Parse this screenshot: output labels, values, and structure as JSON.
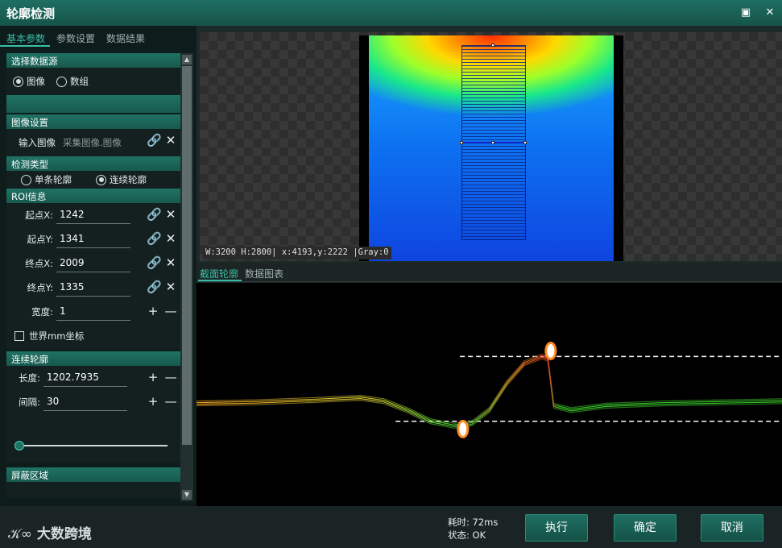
{
  "window": {
    "title": "轮廓检测"
  },
  "left_tabs": [
    "基本参数",
    "参数设置",
    "数据结果"
  ],
  "datasource": {
    "header": "选择数据源",
    "options": [
      {
        "label": "图像",
        "selected": true
      },
      {
        "label": "数组",
        "selected": false
      }
    ]
  },
  "image_settings": {
    "header": "图像设置",
    "label": "输入图像",
    "value": "采集图像.图像"
  },
  "detect_type": {
    "header": "检测类型",
    "options": [
      {
        "label": "单条轮廓",
        "selected": false
      },
      {
        "label": "连续轮廓",
        "selected": true
      }
    ]
  },
  "roi": {
    "header": "ROI信息",
    "fields": [
      {
        "label": "起点X:",
        "value": "1242"
      },
      {
        "label": "起点Y:",
        "value": "1341"
      },
      {
        "label": "终点X:",
        "value": "2009"
      },
      {
        "label": "终点Y:",
        "value": "1335"
      }
    ],
    "width_label": "宽度:",
    "width_value": "1",
    "world_checkbox": "世界mm坐标"
  },
  "continuous": {
    "header": "连续轮廓",
    "length_label": "长度:",
    "length_value": "1202.7935",
    "interval_label": "间隔:",
    "interval_value": "30"
  },
  "mask": {
    "header": "屏蔽区域"
  },
  "viewer": {
    "status": "W:3200 H:2800| x:4193,y:2222 |Gray:0"
  },
  "chart_tabs": [
    "截面轮廓",
    "数据图表"
  ],
  "footer": {
    "logo": "大数跨境",
    "time": "耗时: 72ms",
    "status": "状态: OK",
    "buttons": [
      "执行",
      "确定",
      "取消"
    ]
  },
  "colors": {
    "accent": "#38c0a6",
    "teal": "#1f7364"
  },
  "chart_data": {
    "type": "line",
    "profile": [
      [
        0,
        0.54
      ],
      [
        0.1,
        0.535
      ],
      [
        0.2,
        0.525
      ],
      [
        0.28,
        0.515
      ],
      [
        0.32,
        0.53
      ],
      [
        0.36,
        0.57
      ],
      [
        0.4,
        0.62
      ],
      [
        0.44,
        0.64
      ],
      [
        0.47,
        0.63
      ],
      [
        0.5,
        0.57
      ],
      [
        0.53,
        0.45
      ],
      [
        0.56,
        0.36
      ],
      [
        0.59,
        0.33
      ],
      [
        0.6,
        0.34
      ],
      [
        0.61,
        0.55
      ],
      [
        0.64,
        0.57
      ],
      [
        0.7,
        0.55
      ],
      [
        0.8,
        0.54
      ],
      [
        0.9,
        0.535
      ],
      [
        1,
        0.53
      ]
    ],
    "upper_line": 0.33,
    "lower_line": 0.62,
    "markers": [
      [
        0.455,
        0.655
      ],
      [
        0.605,
        0.305
      ]
    ]
  }
}
